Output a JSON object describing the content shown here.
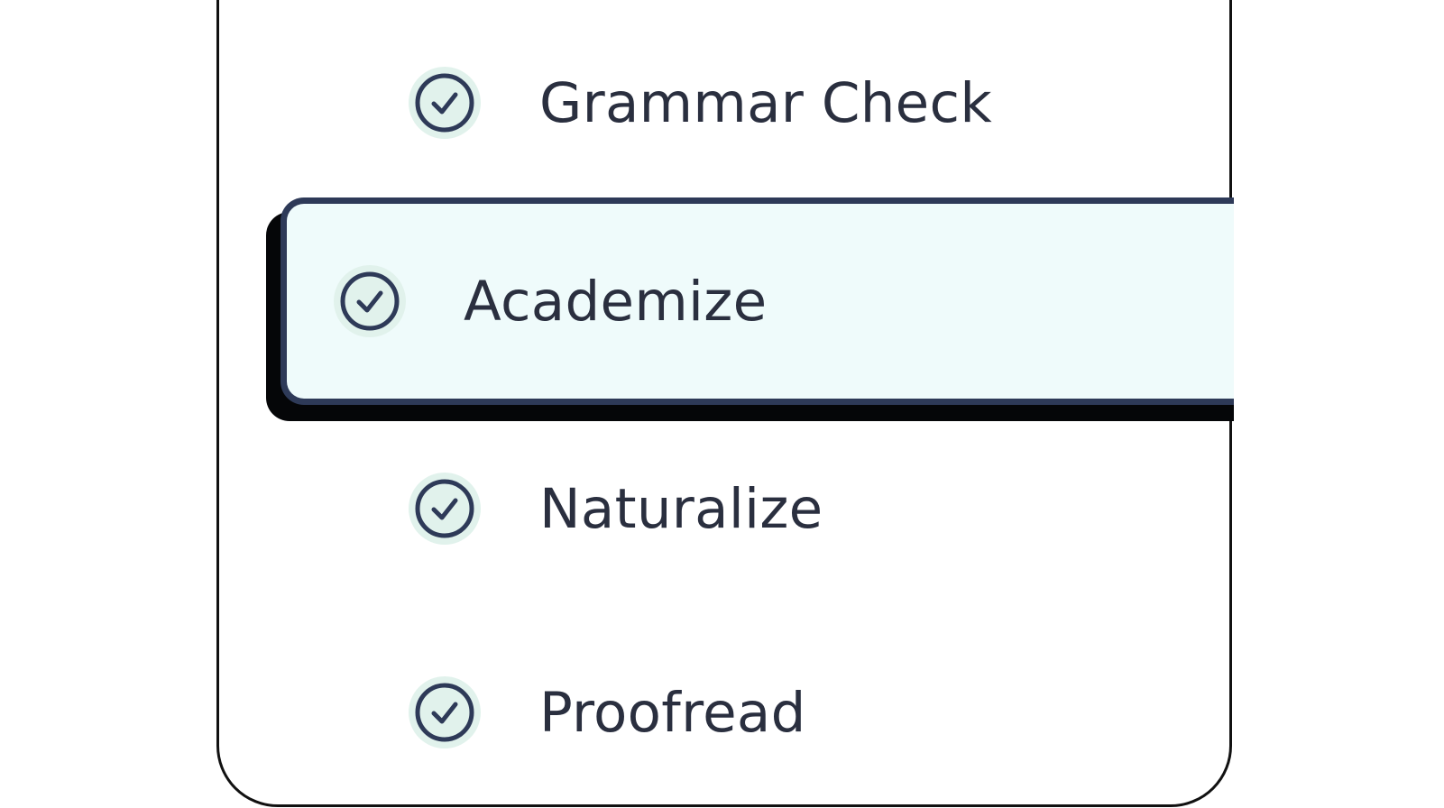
{
  "options": [
    {
      "label": "Grammar Check",
      "selected": false
    },
    {
      "label": "Academize",
      "selected": true
    },
    {
      "label": "Naturalize",
      "selected": false
    },
    {
      "label": "Proofread",
      "selected": false
    }
  ],
  "icons": {
    "check": "check-circle-icon"
  },
  "colors": {
    "text": "#2a2f3f",
    "icon_stroke": "#2e3a58",
    "icon_fill": "#e1f2ec",
    "selected_bg": "#effbfb",
    "selected_border": "#2e3a58",
    "panel_border": "#111111"
  }
}
